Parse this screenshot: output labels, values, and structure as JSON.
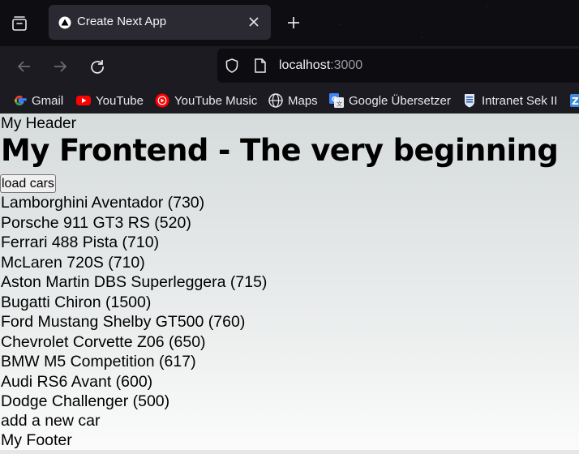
{
  "browser": {
    "tab": {
      "title": "Create Next App"
    },
    "url": {
      "host": "localhost",
      "port": ":3000"
    },
    "bookmarks": [
      {
        "label": "Gmail",
        "icon": "google-icon"
      },
      {
        "label": "YouTube",
        "icon": "youtube-icon"
      },
      {
        "label": "YouTube Music",
        "icon": "youtube-music-icon"
      },
      {
        "label": "Maps",
        "icon": "globe-icon"
      },
      {
        "label": "Google Übersetzer",
        "icon": "google-translate-icon"
      },
      {
        "label": "Intranet Sek II",
        "icon": "intranet-icon"
      }
    ]
  },
  "page": {
    "header": "My Header",
    "title": "My Frontend - The very beginning",
    "load_button": "load cars",
    "cars": [
      "Lamborghini Aventador (730)",
      "Porsche 911 GT3 RS (520)",
      "Ferrari 488 Pista (710)",
      "McLaren 720S (710)",
      "Aston Martin DBS Superleggera (715)",
      "Bugatti Chiron (1500)",
      "Ford Mustang Shelby GT500 (760)",
      "Chevrolet Corvette Z06 (650)",
      "BMW M5 Competition (617)",
      "Audi RS6 Avant (600)",
      "Dodge Challenger (500)"
    ],
    "add_car": "add a new car",
    "footer": "My Footer"
  }
}
